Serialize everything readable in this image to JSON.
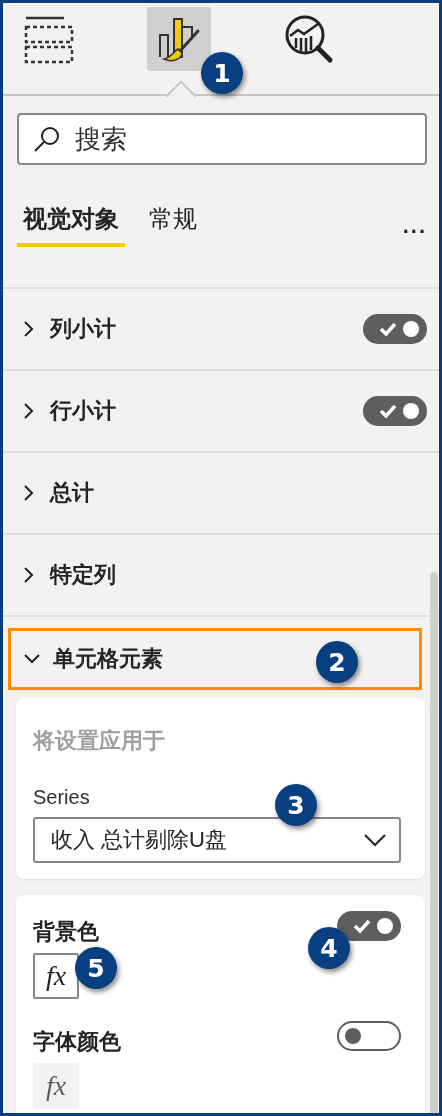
{
  "toolbar": {
    "panes": [
      {
        "kind": "fields",
        "selected": false
      },
      {
        "kind": "format",
        "selected": true,
        "callout": "1"
      },
      {
        "kind": "analytics",
        "selected": false
      }
    ]
  },
  "search": {
    "placeholder": "搜索"
  },
  "tabs": [
    {
      "label": "视觉对象",
      "selected": true
    },
    {
      "label": "常规",
      "selected": false
    }
  ],
  "more_button": "...",
  "sections": [
    {
      "label": "列小计",
      "expanded": false,
      "toggle_on": true
    },
    {
      "label": "行小计",
      "expanded": false,
      "toggle_on": true
    },
    {
      "label": "总计",
      "expanded": false
    },
    {
      "label": "特定列",
      "expanded": false
    },
    {
      "label": "单元格元素",
      "expanded": true,
      "highlighted": true,
      "callout": "2"
    }
  ],
  "apply_card": {
    "title": "将设置应用于",
    "field_label": "Series",
    "dropdown": {
      "value": "收入 总计剔除U盘",
      "callout": "3"
    }
  },
  "settings": [
    {
      "label": "背景色",
      "on": true,
      "fx": "fx",
      "toggle_callout": "4",
      "fx_callout": "5"
    },
    {
      "label": "字体颜色",
      "on": false,
      "fx": "fx"
    }
  ]
}
